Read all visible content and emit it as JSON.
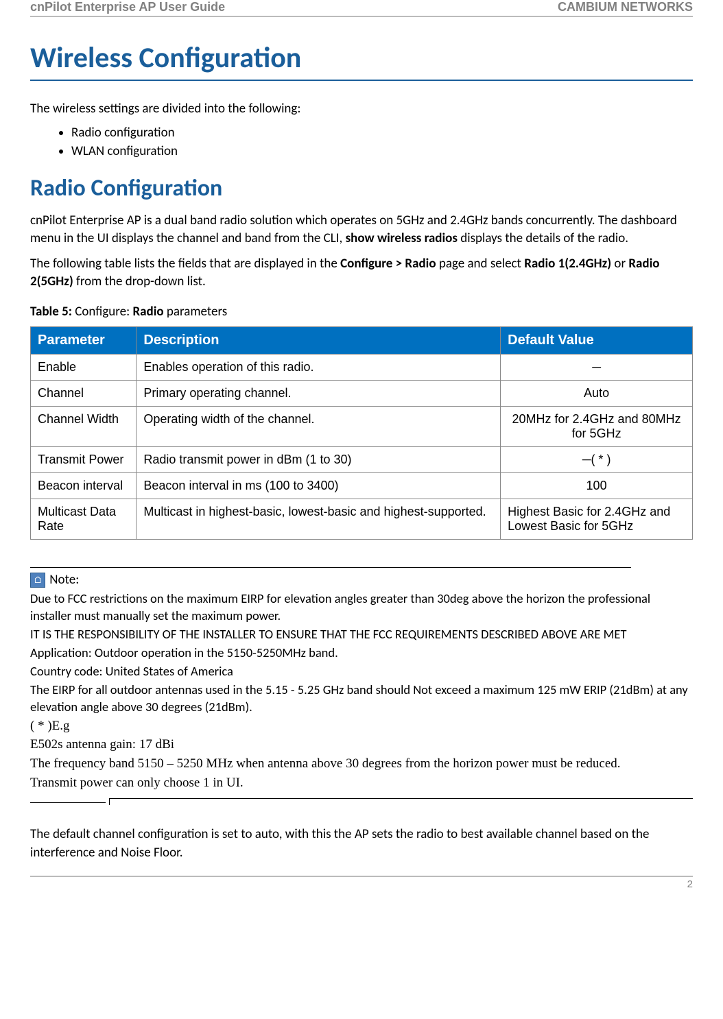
{
  "header": {
    "left": "cnPilot Enterprise AP User Guide",
    "right": "CAMBIUM NETWORKS"
  },
  "title": "Wireless Configuration",
  "intro": "The wireless settings are divided into the following:",
  "bullets": [
    "Radio configuration",
    "WLAN configuration"
  ],
  "section2_title": "Radio Configuration",
  "para1_pre": "cnPilot Enterprise AP is a dual band radio solution which operates on 5GHz and 2.4GHz bands concurrently. The dashboard menu in the UI displays the channel and band from the CLI, ",
  "para1_bold": "show wireless radios",
  "para1_post": " displays the details of the radio.",
  "para2_a": "The following table lists the fields that are displayed in the ",
  "para2_b_bold": "Configure > Radio",
  "para2_c": " page and select ",
  "para2_d_bold": "Radio 1(2.4GHz)",
  "para2_e": " or ",
  "para2_f_bold": "Radio 2(5GHz)",
  "para2_g": " from the drop-down list.",
  "table_caption_a": "Table 5:",
  "table_caption_b": " Configure: ",
  "table_caption_c": "Radio",
  "table_caption_d": " parameters",
  "table": {
    "headers": [
      "Parameter",
      "Description",
      "Default Value"
    ],
    "rows": [
      {
        "param": "Enable",
        "desc": "Enables operation of this radio.",
        "def": "─",
        "center": true
      },
      {
        "param": "Channel",
        "desc": "Primary operating channel.",
        "def": "Auto",
        "center": true
      },
      {
        "param": "Channel Width",
        "desc": "Operating width of the channel.",
        "def": "20MHz for 2.4GHz and 80MHz for 5GHz",
        "center": true
      },
      {
        "param": "Transmit Power",
        "desc": "Radio transmit power in dBm (1 to 30)",
        "def": "─( * )",
        "center": true
      },
      {
        "param": "Beacon interval",
        "desc": "Beacon interval in ms (100 to 3400)",
        "def": "100",
        "center": true
      },
      {
        "param": "Multicast Data Rate",
        "desc": "Multicast in highest-basic, lowest-basic and highest-supported.",
        "def": "Highest Basic for 2.4GHz and Lowest Basic for 5GHz",
        "center": false
      }
    ]
  },
  "note_label": " Note:",
  "note_lines": [
    "Due to FCC restrictions on the maximum EIRP for elevation angles greater than 30deg above the horizon the professional installer must manually set the maximum power.",
    "IT IS THE RESPONSIBILITY OF THE INSTALLER TO ENSURE THAT THE FCC REQUIREMENTS DESCRIBED ABOVE ARE MET",
    "Application: Outdoor operation in the 5150-5250MHz band.",
    "Country code: United States of America",
    "The EIRP for all outdoor antennas used in the 5.15 - 5.25 GHz band should Not exceed a maximum 125 mW ERIP (21dBm) at any elevation angle above 30 degrees (21dBm)."
  ],
  "note_serif": [
    "( * )E.g",
    "E502s antenna gain: 17 dBi",
    "The frequency band 5150 – 5250 MHz when antenna above 30 degrees from the horizon power must be reduced.",
    "Transmit power can only choose 1 in UI."
  ],
  "closing": "The default channel configuration is set to auto, with this the AP sets the radio to best available channel based on the interference and Noise Floor.",
  "page_number": "2"
}
